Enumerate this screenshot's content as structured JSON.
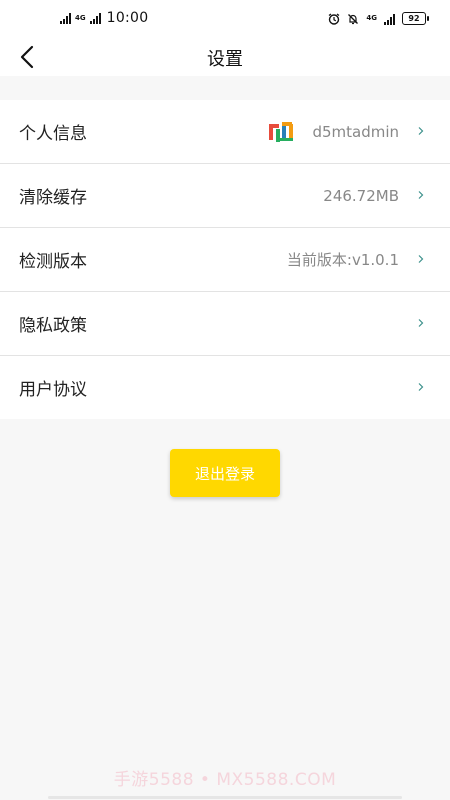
{
  "status_bar": {
    "network_left": "4G",
    "time": "10:00",
    "network_right": "4G",
    "battery": "92"
  },
  "nav": {
    "title": "设置"
  },
  "settings": {
    "items": [
      {
        "label": "个人信息",
        "value": "d5mtadmin",
        "has_logo": true
      },
      {
        "label": "清除缓存",
        "value": "246.72MB"
      },
      {
        "label": "检测版本",
        "value": "当前版本:v1.0.1"
      },
      {
        "label": "隐私政策",
        "value": ""
      },
      {
        "label": "用户协议",
        "value": ""
      }
    ]
  },
  "logout": {
    "label": "退出登录"
  },
  "watermark": "手游5588 • MX5588.COM",
  "colors": {
    "accent": "#ffd800",
    "chevron": "#3a8f8a",
    "background": "#f7f7f7"
  }
}
